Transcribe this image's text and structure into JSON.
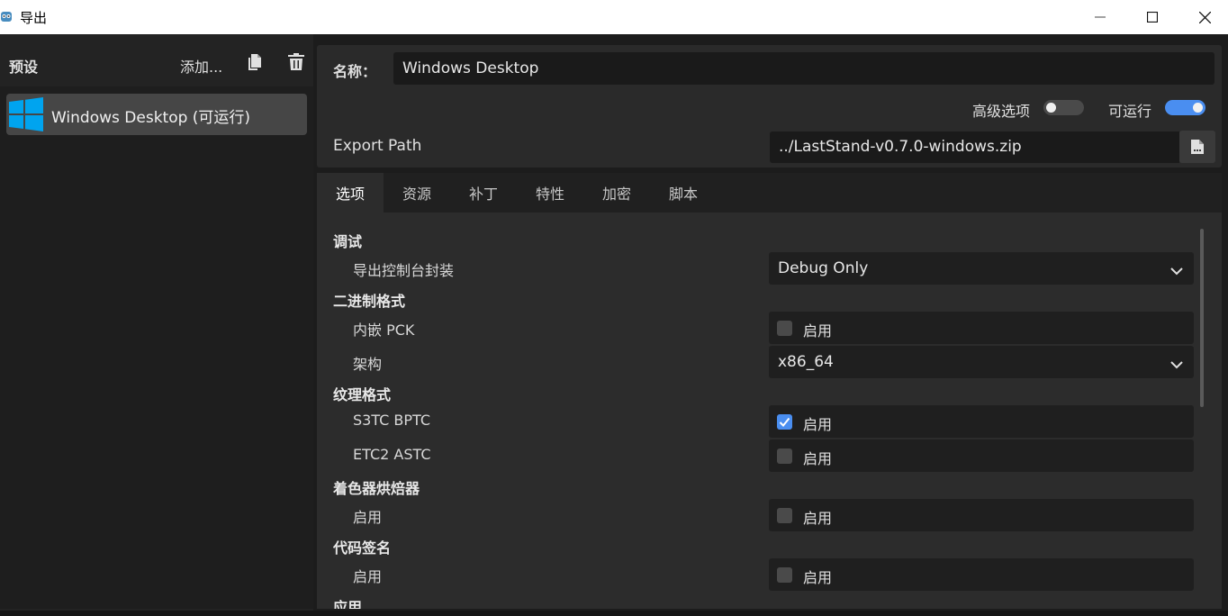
{
  "window": {
    "title": "导出",
    "controls": [
      "minimize",
      "maximize",
      "close"
    ]
  },
  "presets": {
    "header": "预设",
    "add_label": "添加...",
    "items": [
      {
        "label": "Windows Desktop (可运行)",
        "icon": "windows-logo-icon",
        "selected": true
      }
    ]
  },
  "preset_settings": {
    "name_label": "名称：",
    "name_value": "Windows Desktop",
    "advanced_options_label": "高级选项",
    "advanced_options_on": false,
    "runnable_label": "可运行",
    "runnable_on": true,
    "export_path_label": "Export Path",
    "export_path_value": "../LastStand-v0.7.0-windows.zip"
  },
  "tabs": [
    {
      "label": "选项",
      "active": true
    },
    {
      "label": "资源",
      "active": false
    },
    {
      "label": "补丁",
      "active": false
    },
    {
      "label": "特性",
      "active": false
    },
    {
      "label": "加密",
      "active": false
    },
    {
      "label": "脚本",
      "active": false
    }
  ],
  "options": {
    "debug": {
      "title": "调试",
      "console_wrapper_label": "导出控制台封装",
      "console_wrapper_value": "Debug Only"
    },
    "binary_format": {
      "title": "二进制格式",
      "embed_pck_label": "内嵌 PCK",
      "embed_pck_checkbox": "启用",
      "embed_pck_checked": false,
      "architecture_label": "架构",
      "architecture_value": "x86_64"
    },
    "texture_format": {
      "title": "纹理格式",
      "s3tc_label": "S3TC BPTC",
      "s3tc_checkbox": "启用",
      "s3tc_checked": true,
      "etc2_label": "ETC2 ASTC",
      "etc2_checkbox": "启用",
      "etc2_checked": false
    },
    "shader_baker": {
      "title": "着色器烘焙器",
      "enabled_label": "启用",
      "enabled_checkbox": "启用",
      "enabled_checked": false
    },
    "codesign": {
      "title": "代码签名",
      "enabled_label": "启用",
      "enabled_checkbox": "启用",
      "enabled_checked": false
    },
    "application": {
      "title": "应用"
    }
  },
  "colors": {
    "accent": "#4a8ef0",
    "panel": "#2c2c2c",
    "field": "#1f1f1f"
  }
}
